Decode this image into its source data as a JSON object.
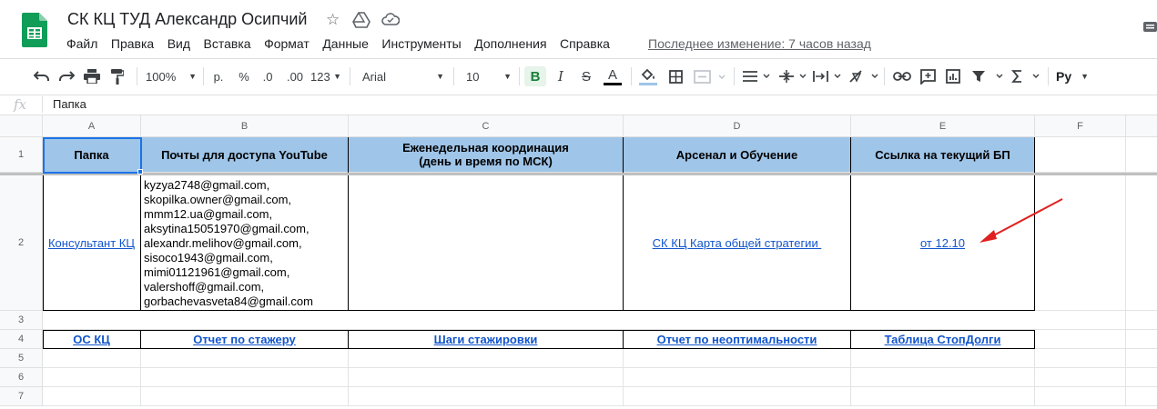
{
  "document": {
    "title": "СК КЦ ТУД Александр Осипчий",
    "last_edit": "Последнее изменение: 7 часов назад"
  },
  "menu": [
    "Файл",
    "Правка",
    "Вид",
    "Вставка",
    "Формат",
    "Данные",
    "Инструменты",
    "Дополнения",
    "Справка"
  ],
  "toolbar": {
    "zoom": "100%",
    "currency": "р.",
    "percent": "%",
    "dec_decrease": ".0",
    "dec_increase": ".00",
    "number_format": "123",
    "font": "Arial",
    "font_size": "10",
    "bold": "B",
    "italic": "I",
    "strike": "S",
    "text_color": "A",
    "input_tools": "Py",
    "text_color_hex": "#000000",
    "fill_color_hex": "#9fc5e8"
  },
  "formula_bar": {
    "fx": "fx",
    "value": "Папка"
  },
  "columns": [
    "A",
    "B",
    "C",
    "D",
    "E",
    "F"
  ],
  "rows": [
    "1",
    "2",
    "3",
    "4",
    "5",
    "6",
    "7"
  ],
  "cells": {
    "header": {
      "a": "Папка",
      "b": "Почты для доступа YouTube",
      "c1": "Еженедельная координация",
      "c2": "(день и время по МСК)",
      "d": "Арсенал и Обучение",
      "e": "Ссылка на текущий БП"
    },
    "row2": {
      "a": "Консультант КЦ",
      "emails": [
        " kyzya2748@gmail.com,",
        "skopilka.owner@gmail.com,",
        "mmm12.ua@gmail.com,",
        "aksytina15051970@gmail.com,",
        "alexandr.melihov@gmail.com,",
        "sisoco1943@gmail.com,",
        "mimi01121961@gmail.com,",
        "valershoff@gmail.com,",
        "gorbachevasveta84@gmail.com"
      ],
      "d": "СК КЦ Карта общей стратегии ",
      "e": "от 12.10"
    },
    "row4": {
      "a": "ОС КЦ",
      "b": "Отчет по стажеру",
      "c": "Шаги стажировки",
      "d": "Отчет по неоптимальности",
      "e": "Таблица СтопДолги"
    }
  },
  "colors": {
    "header_fill": "#9fc5e8",
    "link": "#1155cc",
    "selection": "#1a73e8",
    "arrow": "#e02020",
    "logo": "#0f9d58"
  }
}
